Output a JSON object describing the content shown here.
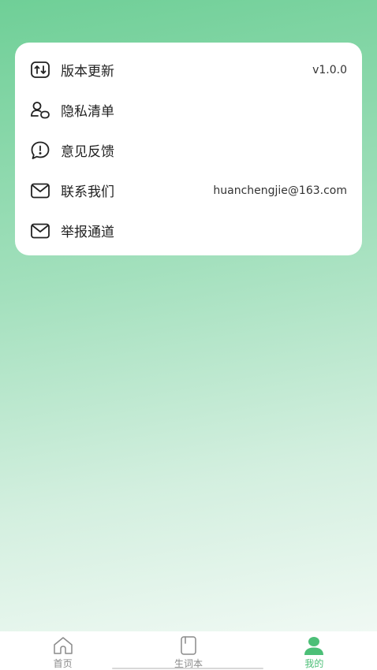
{
  "menu": {
    "items": [
      {
        "label": "版本更新",
        "value": "v1.0.0",
        "icon": "update-icon"
      },
      {
        "label": "隐私清单",
        "value": "",
        "icon": "privacy-icon"
      },
      {
        "label": "意见反馈",
        "value": "",
        "icon": "feedback-icon"
      },
      {
        "label": "联系我们",
        "value": "huanchengjie@163.com",
        "icon": "mail-icon"
      },
      {
        "label": "举报通道",
        "value": "",
        "icon": "mail-icon"
      }
    ]
  },
  "tabbar": {
    "tabs": [
      {
        "label": "首页",
        "icon": "home-icon",
        "active": false
      },
      {
        "label": "生词本",
        "icon": "notebook-icon",
        "active": false
      },
      {
        "label": "我的",
        "icon": "profile-icon",
        "active": true
      }
    ]
  },
  "colors": {
    "accent": "#4cbf77",
    "inactive": "#8a8a8a"
  }
}
